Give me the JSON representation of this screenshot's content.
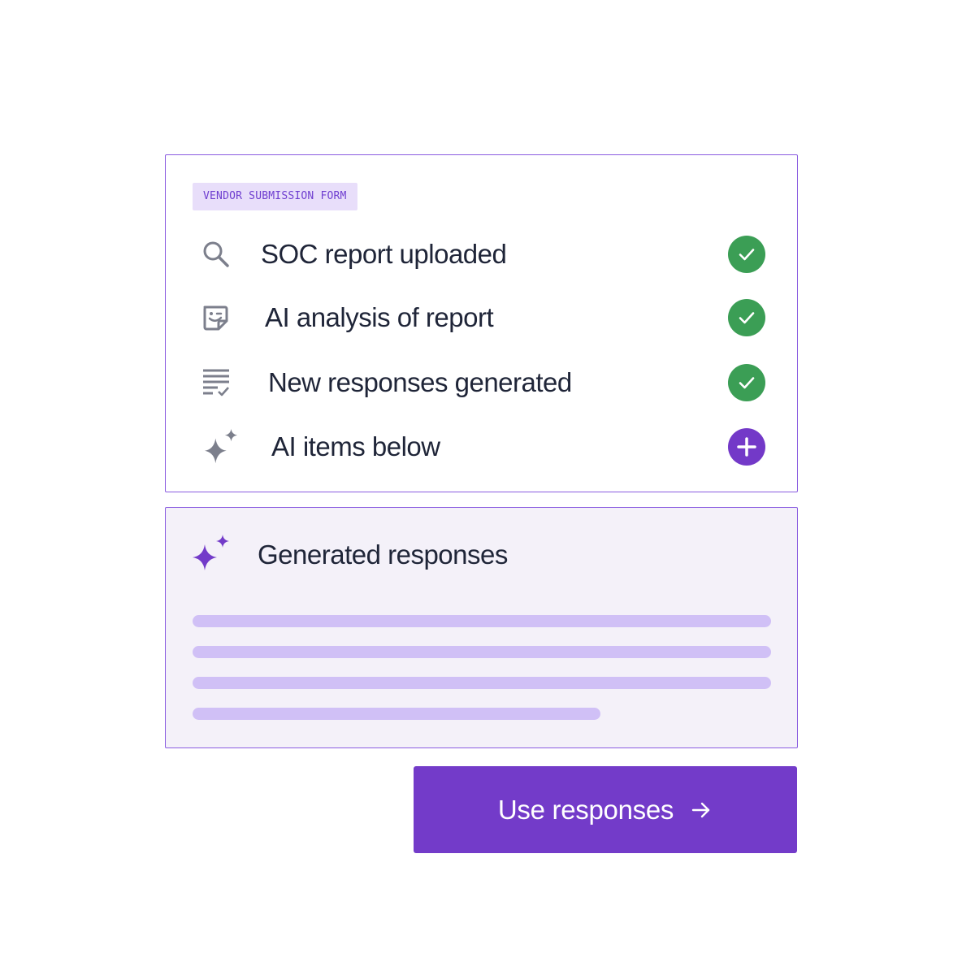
{
  "form": {
    "tag": "VENDOR SUBMISSION FORM",
    "items": [
      {
        "label": "SOC report uploaded",
        "icon": "search-icon",
        "status": "complete",
        "status_icon": "check-icon"
      },
      {
        "label": "AI analysis of report",
        "icon": "sticky-note-smile-icon",
        "status": "complete",
        "status_icon": "check-icon"
      },
      {
        "label": "New responses generated",
        "icon": "checklist-icon",
        "status": "complete",
        "status_icon": "check-icon"
      },
      {
        "label": "AI items below",
        "icon": "sparkles-icon",
        "status": "add",
        "status_icon": "plus-icon"
      }
    ]
  },
  "generated": {
    "title": "Generated responses",
    "icon": "sparkles-icon"
  },
  "action": {
    "label": "Use responses",
    "icon": "arrow-right-icon"
  },
  "colors": {
    "accent": "#733bc9",
    "border": "#8a5ce0",
    "tag_bg": "#e8defa",
    "success": "#3b9e55",
    "placeholder_line": "#d0c0f6",
    "panel_bg": "#f4f1f9",
    "icon_gray": "#7c7f8c",
    "text": "#1f2538"
  }
}
